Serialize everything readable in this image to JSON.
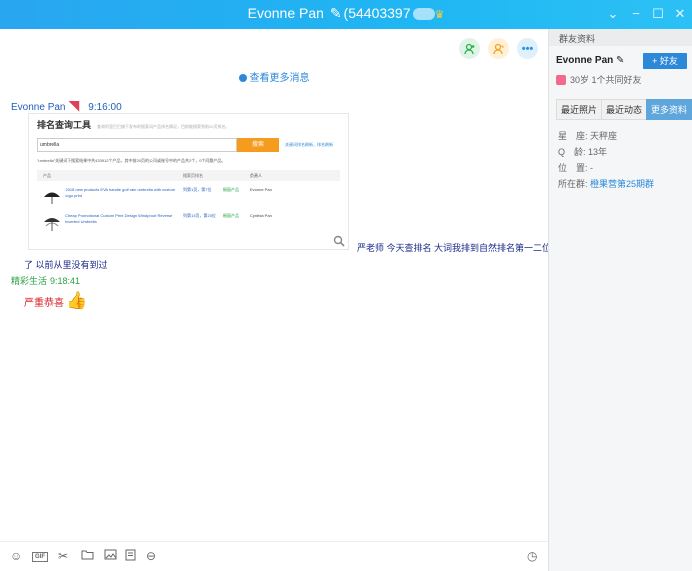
{
  "window": {
    "title_name": "Evonne Pan",
    "title_pen": "✎",
    "title_qq": "(54403397",
    "title_tail": "♛"
  },
  "chat": {
    "more_messages": "查看更多消息",
    "messages": [
      {
        "sender": "Evonne Pan",
        "time": "9:16:00",
        "image_card": {
          "title": "排名查询工具",
          "subtitle": "查询阿里巴巴旗下发布的搜索词产品排名情况，目前能搜索到前20页排名。",
          "search_value": "umbrella",
          "search_button": "搜索",
          "search_link": "关键词排名刷新，排名刷新",
          "result_text": "\"umbrella\"关键词下搜索结果中共433912个产品，其中前20页的公司或账号中的产品共2个，0个问题产品。",
          "headers": [
            "产品",
            "搜索页排名",
            "负责人"
          ],
          "rows": [
            {
              "product": "2018 new products EVA handle golf rain umbrella with custom logo print",
              "rank": "列第1页，第7位",
              "status": "橱窗产品",
              "owner": "Evonne Pan"
            },
            {
              "product": "Cheap Promotional Custom Print Design Windproof Reverse Inverted Umbrella",
              "rank": "列第13页，第23位",
              "status": "橱窗产品",
              "owner": "Cynthia Pan"
            }
          ]
        },
        "text_line1": "严老师 今天查排名 大词我排到自然排名第一二位",
        "text_line2": "了 以前从里没有到过"
      },
      {
        "sender": "精彩生活",
        "time": "9:18:41",
        "text": "严重恭喜"
      }
    ]
  },
  "toolbar": {
    "icons": [
      "smile-icon",
      "gif-icon",
      "scissors-icon",
      "folder-icon",
      "image-icon",
      "doc-icon",
      "more-icon",
      "history-icon"
    ],
    "gif_label": "GIF"
  },
  "panel": {
    "header": "群友资料",
    "name": "Evonne Pan",
    "add_friend": "+ 好友",
    "age_text": "30岁 1个共同好友",
    "tabs": [
      "最近照片",
      "最近动态",
      "更多资料"
    ],
    "info": {
      "star_label": "星　座:",
      "star_value": "天秤座",
      "q_label": "Q　龄:",
      "q_value": "13年",
      "loc_label": "位　置:",
      "loc_value": "-",
      "group_label": "所在群:",
      "group_value": "橙果营第25期群"
    }
  },
  "colors": {
    "titlebar": "#29a6f0",
    "accent": "#2c88d9",
    "sender_blue": "#1d5fbd",
    "sender_green": "#27a344",
    "congrats_red": "#d8232a"
  }
}
